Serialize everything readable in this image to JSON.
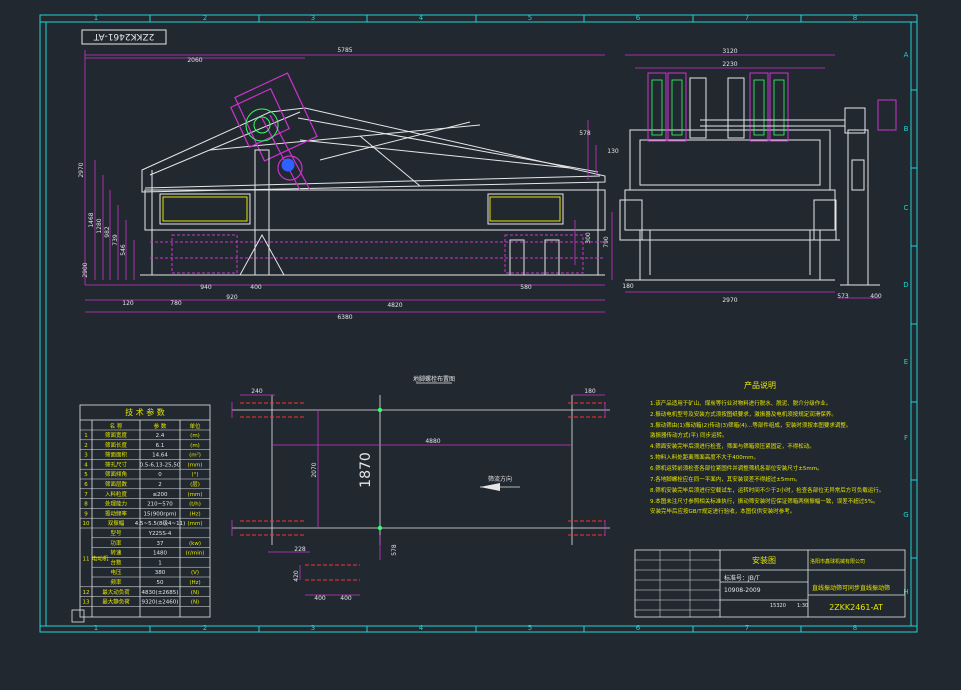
{
  "drawing": {
    "title_stamp": "2ZKK2461-AT",
    "colors": {
      "background": "#212830",
      "frame": "#1fd3d3",
      "outline": "#e6e6e6",
      "machine": "#cc33cc",
      "red": "#ff3030",
      "yellow": "#e6e600",
      "green": "#33ff66",
      "blue": "#3060ff"
    }
  },
  "grid": {
    "columns": [
      "1",
      "2",
      "3",
      "4",
      "5",
      "6",
      "7",
      "8"
    ],
    "rows": [
      "A",
      "B",
      "C",
      "D",
      "E",
      "F",
      "G",
      "H"
    ]
  },
  "side_view": {
    "dims": {
      "overall_length": "5785",
      "left_offset": "2060",
      "total_base": "6380",
      "span": "4820",
      "tail": "120",
      "left_leg": "780",
      "leg_spacing": "920",
      "foot": "400",
      "foot_right": "940",
      "foot_far": "580",
      "discharge_h": "578",
      "lip_h": "130",
      "overall_h": "2970",
      "frame_h": "1468",
      "h1": "1280",
      "h2": "982",
      "h3": "739",
      "h4": "546",
      "h5": "300",
      "h6": "2900"
    }
  },
  "end_view": {
    "dims": {
      "top_width": "3120",
      "motor_width": "2230",
      "base_width": "2970",
      "left_small": "180",
      "right_a": "573",
      "right_b": "400",
      "height": "790"
    }
  },
  "foundation_plan": {
    "title": "地脚螺栓布置图",
    "dims": {
      "corner_left": "240",
      "corner_right": "180",
      "between_bolts": "4880",
      "center_span": "1870",
      "side_span": "2070",
      "offset_left": "228",
      "offset_right": "578",
      "detail_h": "420",
      "detail_w1": "400",
      "detail_w2": "400"
    },
    "flow_label": "筛流方向"
  },
  "notes": {
    "title": "产品说明",
    "items": [
      "1.该产品适用于矿山、煤炭等行业对物料进行脱水、脱泥、脱介分级作业。",
      "2.振动电机型号及安装方式须按图纸要求，激振器及电机须按规定润滑保养。",
      "3.振动筛由(1)振动箱(2)传动(3)筛箱(4)…等部件组成，安装时须按本图要求调整。",
      "   激振器传动方式(平)  同步运转。",
      "4.筛面安装完毕后须进行检查，筛面与筛箱须压紧固定，不得松动。",
      "5.物料入料处距离筛面高度不大于400mm。",
      "6.筛机运转前须检查各部位紧固件并调整筛机各部位安装尺寸±5mm。",
      "7.各地脚螺栓应在同一平面内，其安装误差不得超过±5mm。",
      "8.筛机安装完毕后须进行空载试车，运转时间不少于2小时，检查各部位无异常后方可负载运行。",
      "9.本图未注尺寸参照相关标准执行，振动筛安装时应保证筛箱两侧振幅一致，误差不超过5%。",
      "   安装完毕后应按GB/T规定进行验收，本图仅供安装时参考。"
    ]
  },
  "tech_params": {
    "title": "技 术 参 数",
    "headers": [
      "名  称",
      "参  数",
      "单位"
    ],
    "rows": [
      {
        "no": "1",
        "name": "筛面宽度",
        "value": "2.4",
        "unit": "(m)"
      },
      {
        "no": "2",
        "name": "筛面长度",
        "value": "6.1",
        "unit": "(m)"
      },
      {
        "no": "3",
        "name": "筛面面积",
        "value": "14.64",
        "unit": "(m²)"
      },
      {
        "no": "4",
        "name": "筛孔尺寸",
        "value": "0.5-6,13-25,50",
        "unit": "(mm)"
      },
      {
        "no": "5",
        "name": "筛面倾角",
        "value": "0",
        "unit": "(°)"
      },
      {
        "no": "6",
        "name": "筛面层数",
        "value": "2",
        "unit": "(层)"
      },
      {
        "no": "7",
        "name": "入料粒度",
        "value": "≤200",
        "unit": "(mm)"
      },
      {
        "no": "8",
        "name": "处理能力",
        "value": "210~570",
        "unit": "(t/h)"
      },
      {
        "no": "9",
        "name": "振动频率",
        "value": "15(900rpm)",
        "unit": "(Hz)"
      },
      {
        "no": "10",
        "name": "双振幅",
        "value": "4.5~5.5(8级4~11)",
        "unit": "(mm)"
      }
    ],
    "motor_group_no": "11",
    "motor_group_label": "电动机",
    "motor_rows": [
      {
        "name": "型号",
        "value": "Y225S-4",
        "unit": ""
      },
      {
        "name": "功率",
        "value": "37",
        "unit": "(kw)"
      },
      {
        "name": "转速",
        "value": "1480",
        "unit": "(r/min)"
      },
      {
        "name": "台数",
        "value": "1",
        "unit": ""
      },
      {
        "name": "电压",
        "value": "380",
        "unit": "(V)"
      },
      {
        "name": "频率",
        "value": "50",
        "unit": "(Hz)"
      }
    ],
    "extra_rows": [
      {
        "no": "12",
        "name": "最大动负荷",
        "value": "4830(±2685)",
        "unit": "(N)"
      },
      {
        "no": "13",
        "name": "最大静负荷",
        "value": "9320(±2460)",
        "unit": "(N)"
      }
    ]
  },
  "title_block": {
    "drawing_type": "安装图",
    "company": "洛阳市鑫球机械有限公司",
    "product_name": "直线振动筛可同步直线振动筛",
    "drawing_no": "2ZKK2461-AT",
    "standard": "标准号：JB/T",
    "year": "10908-2009",
    "scale": "1:30",
    "weight": "15320"
  }
}
